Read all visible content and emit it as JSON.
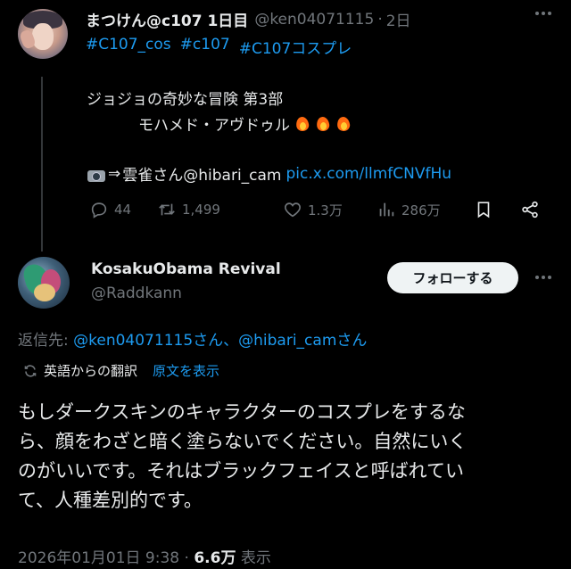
{
  "original_tweet": {
    "display_name": "まつけん@c107 1日目",
    "handle": "@ken04071115",
    "separator": "·",
    "time": "2日",
    "hashtags": [
      "#C107_cos",
      "#c107",
      "#C107コスプレ"
    ],
    "line1": "ジョジョの奇妙な冒険 第3部",
    "line2": "モハメド・アヴドゥル",
    "line3_arrow": "⇒",
    "line3_text": "雲雀さん@hibari_cam",
    "line3_link": "pic.x.com/llmfCNVfHu",
    "stats": {
      "replies": "44",
      "retweets": "1,499",
      "likes": "1.3万",
      "views": "286万"
    },
    "icons": [
      "reply-icon",
      "retweet-icon",
      "like-icon",
      "views-icon",
      "bookmark-icon",
      "share-icon"
    ]
  },
  "reply_tweet": {
    "display_name": "KosakuObama Revival",
    "handle": "@Raddkann",
    "follow_label": "フォローする",
    "replying_prefix": "返信先: ",
    "replying_mentions": "@ken04071115さん、@hibari_camさん",
    "translate_label": "英語からの翻訳",
    "translate_link": "原文を表示",
    "text_lines": [
      "もしダークスキンのキャラクターのコスプレをするな",
      "ら、顔をわざと暗く塗らないでください。自然にいく",
      "のがいいです。それはブラックフェイスと呼ばれてい",
      "て、人種差別的です。"
    ],
    "timestamp": "2026年01月01日 9:38",
    "meta_sep": " · ",
    "views_count": "6.6万",
    "views_label": " 表示"
  },
  "colors": {
    "background": "#000000",
    "text": "#e7e9ea",
    "muted": "#71767b",
    "accent": "#1d9bf0",
    "follow_button_bg": "#eff3f4"
  }
}
